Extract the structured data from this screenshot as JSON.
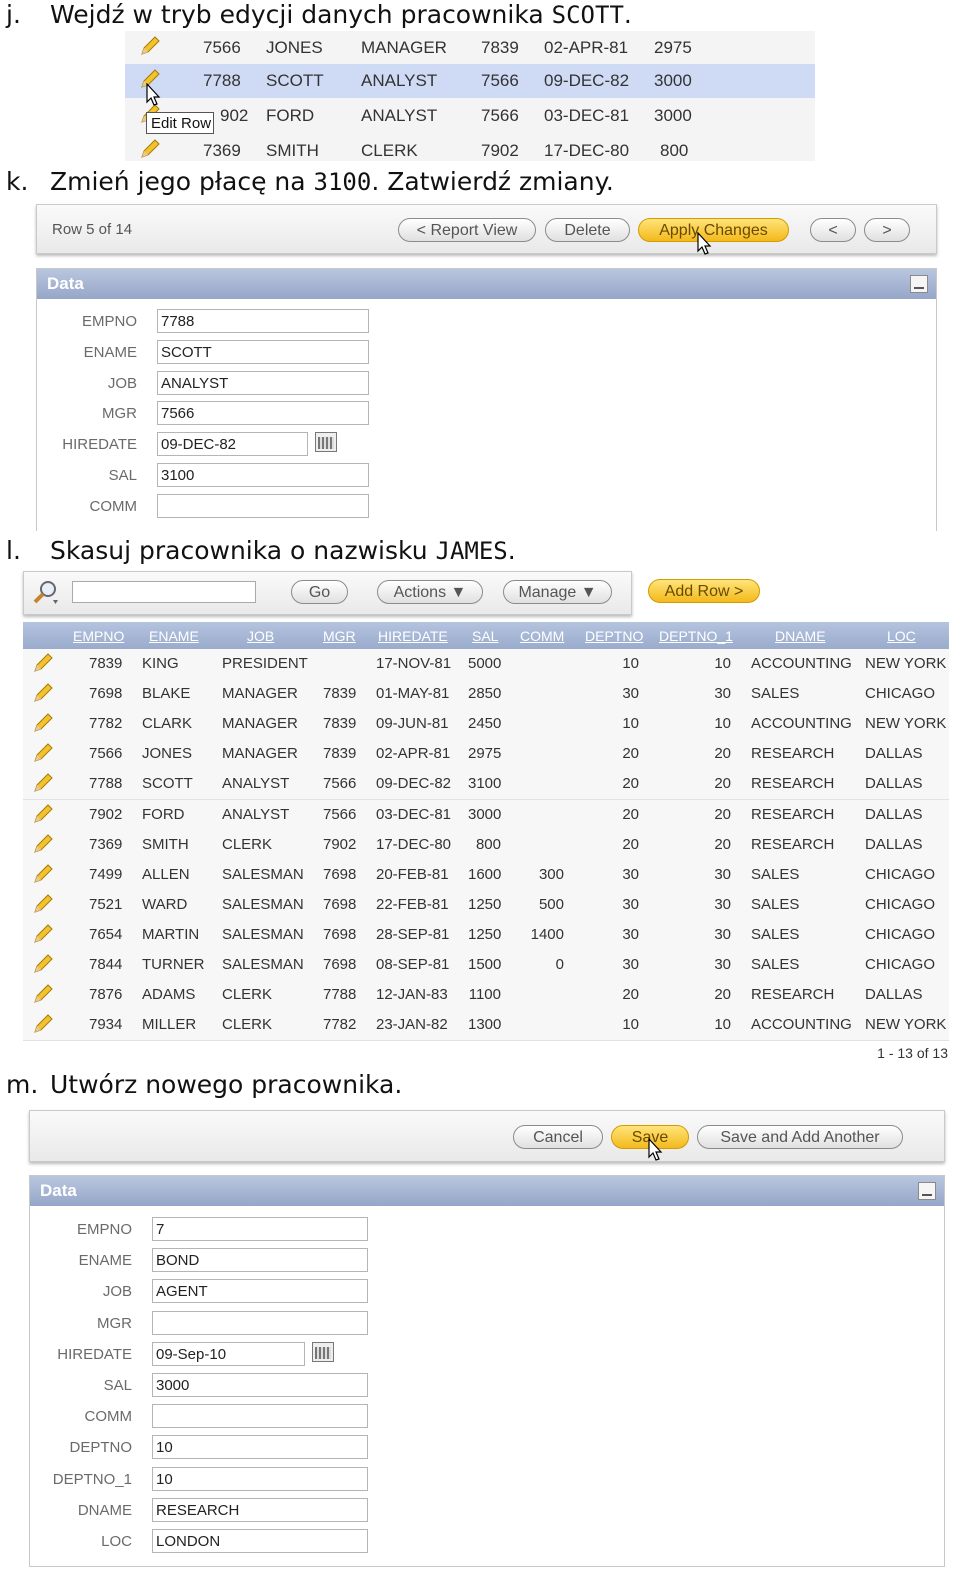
{
  "step_j": {
    "letter": "j.",
    "text": "Wejdź w tryb edycji danych pracownika ",
    "name": "SCOTT",
    "end": "."
  },
  "snippet": {
    "rows": [
      {
        "empno": "7566",
        "ename": "JONES",
        "job": "MANAGER",
        "mgr": "7839",
        "hiredate": "02-APR-81",
        "sal": "2975"
      },
      {
        "empno": "7788",
        "ename": "SCOTT",
        "job": "ANALYST",
        "mgr": "7566",
        "hiredate": "09-DEC-82",
        "sal": "3000"
      },
      {
        "empno": "7902",
        "ename": "FORD",
        "job": "ANALYST",
        "mgr": "7566",
        "hiredate": "03-DEC-81",
        "sal": "3000"
      },
      {
        "empno": "7369",
        "ename": "SMITH",
        "job": "CLERK",
        "mgr": "7902",
        "hiredate": "17-DEC-80",
        "sal": "800"
      }
    ],
    "tooltip": "Edit Row",
    "partial_empno": "902"
  },
  "step_k": {
    "letter": "k.",
    "text": "Zmień jego płacę na ",
    "value": "3100",
    "end": ". Zatwierdź zmiany."
  },
  "edit_bar": {
    "row_info": "Row 5 of 14",
    "report_view": "< Report View",
    "delete": "Delete",
    "apply": "Apply Changes",
    "prev": "<",
    "next": ">"
  },
  "edit_panel": {
    "title": "Data",
    "fields": [
      {
        "label": "EMPNO",
        "value": "7788"
      },
      {
        "label": "ENAME",
        "value": "SCOTT"
      },
      {
        "label": "JOB",
        "value": "ANALYST"
      },
      {
        "label": "MGR",
        "value": "7566"
      },
      {
        "label": "HIREDATE",
        "value": "09-DEC-82"
      },
      {
        "label": "SAL",
        "value": "3100"
      },
      {
        "label": "COMM",
        "value": ""
      }
    ]
  },
  "step_l": {
    "letter": "l.",
    "text": "Skasuj pracownika o nazwisku ",
    "name": "JAMES",
    "end": "."
  },
  "report_bar": {
    "go": "Go",
    "actions": "Actions",
    "manage": "Manage",
    "add_row": "Add Row >"
  },
  "report": {
    "headers": [
      "EMPNO",
      "ENAME",
      "JOB",
      "MGR",
      "HIREDATE",
      "SAL",
      "COMM",
      "DEPTNO",
      "DEPTNO_1",
      "DNAME",
      "LOC"
    ],
    "rows": [
      [
        "7839",
        "KING",
        "PRESIDENT",
        "",
        "17-NOV-81",
        "5000",
        "",
        "10",
        "10",
        "ACCOUNTING",
        "NEW YORK"
      ],
      [
        "7698",
        "BLAKE",
        "MANAGER",
        "7839",
        "01-MAY-81",
        "2850",
        "",
        "30",
        "30",
        "SALES",
        "CHICAGO"
      ],
      [
        "7782",
        "CLARK",
        "MANAGER",
        "7839",
        "09-JUN-81",
        "2450",
        "",
        "10",
        "10",
        "ACCOUNTING",
        "NEW YORK"
      ],
      [
        "7566",
        "JONES",
        "MANAGER",
        "7839",
        "02-APR-81",
        "2975",
        "",
        "20",
        "20",
        "RESEARCH",
        "DALLAS"
      ],
      [
        "7788",
        "SCOTT",
        "ANALYST",
        "7566",
        "09-DEC-82",
        "3100",
        "",
        "20",
        "20",
        "RESEARCH",
        "DALLAS"
      ],
      [
        "7902",
        "FORD",
        "ANALYST",
        "7566",
        "03-DEC-81",
        "3000",
        "",
        "20",
        "20",
        "RESEARCH",
        "DALLAS"
      ],
      [
        "7369",
        "SMITH",
        "CLERK",
        "7902",
        "17-DEC-80",
        "800",
        "",
        "20",
        "20",
        "RESEARCH",
        "DALLAS"
      ],
      [
        "7499",
        "ALLEN",
        "SALESMAN",
        "7698",
        "20-FEB-81",
        "1600",
        "300",
        "30",
        "30",
        "SALES",
        "CHICAGO"
      ],
      [
        "7521",
        "WARD",
        "SALESMAN",
        "7698",
        "22-FEB-81",
        "1250",
        "500",
        "30",
        "30",
        "SALES",
        "CHICAGO"
      ],
      [
        "7654",
        "MARTIN",
        "SALESMAN",
        "7698",
        "28-SEP-81",
        "1250",
        "1400",
        "30",
        "30",
        "SALES",
        "CHICAGO"
      ],
      [
        "7844",
        "TURNER",
        "SALESMAN",
        "7698",
        "08-SEP-81",
        "1500",
        "0",
        "30",
        "30",
        "SALES",
        "CHICAGO"
      ],
      [
        "7876",
        "ADAMS",
        "CLERK",
        "7788",
        "12-JAN-83",
        "1100",
        "",
        "20",
        "20",
        "RESEARCH",
        "DALLAS"
      ],
      [
        "7934",
        "MILLER",
        "CLERK",
        "7782",
        "23-JAN-82",
        "1300",
        "",
        "10",
        "10",
        "ACCOUNTING",
        "NEW YORK"
      ]
    ],
    "pagination": "1 - 13 of 13"
  },
  "step_m": {
    "letter": "m.",
    "text": "Utwórz nowego pracownika."
  },
  "create_bar": {
    "cancel": "Cancel",
    "save": "Save",
    "save_another": "Save and Add Another"
  },
  "create_panel": {
    "title": "Data",
    "fields": [
      {
        "label": "EMPNO",
        "value": "7"
      },
      {
        "label": "ENAME",
        "value": "BOND"
      },
      {
        "label": "JOB",
        "value": "AGENT"
      },
      {
        "label": "MGR",
        "value": ""
      },
      {
        "label": "HIREDATE",
        "value": "09-Sep-10"
      },
      {
        "label": "SAL",
        "value": "3000"
      },
      {
        "label": "COMM",
        "value": ""
      },
      {
        "label": "DEPTNO",
        "value": "10"
      },
      {
        "label": "DEPTNO_1",
        "value": "10"
      },
      {
        "label": "DNAME",
        "value": "RESEARCH"
      },
      {
        "label": "LOC",
        "value": "LONDON"
      }
    ]
  },
  "colors": {
    "selected_row": "#cfdaf5",
    "header_blue": "#9aabcc",
    "gold_button": "#f3b91c"
  }
}
